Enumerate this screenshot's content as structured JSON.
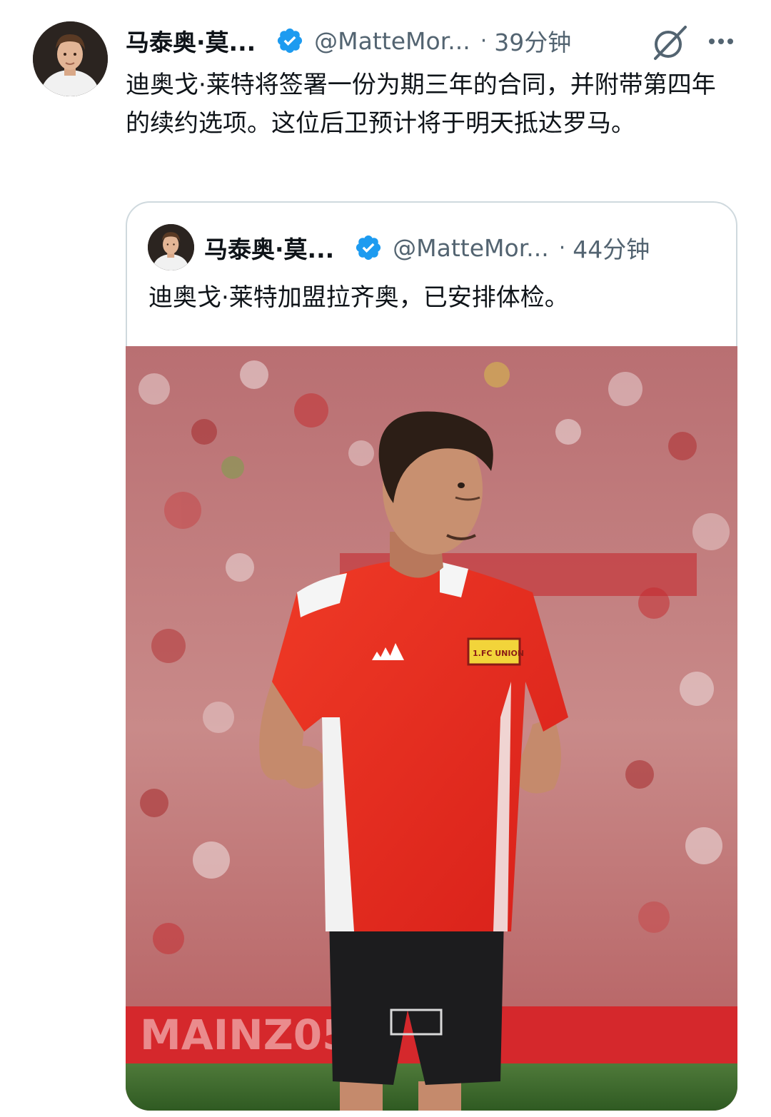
{
  "post": {
    "author": {
      "display_name": "马泰奥·莫...",
      "handle": "@MatteMor...",
      "time": "39分钟",
      "verified": true
    },
    "separator": "·",
    "text": "迪奥戈·莱特将签署一份为期三年的合同，并附带第四年的续约选项。这位后卫预计将于明天抵达罗马。",
    "icons": [
      "grok-icon",
      "more-icon"
    ]
  },
  "quoted_post": {
    "author": {
      "display_name": "马泰奥·莫...",
      "handle": "@MatteMor...",
      "time": "44分钟",
      "verified": true
    },
    "separator": "·",
    "text": "迪奥戈·莱特加盟拉齐奥，已安排体检。",
    "media": {
      "jersey_sponsor": "adidas",
      "crest": "1.FC UNION",
      "board_text": "MAINZ05"
    }
  },
  "colors": {
    "verified_blue": "#1d9bf0",
    "secondary_text": "#536471",
    "card_border": "#cfd9de",
    "jersey_red": "#e32219"
  }
}
